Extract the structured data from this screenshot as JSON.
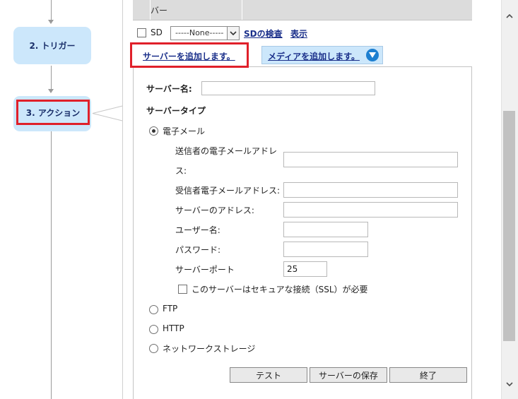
{
  "steps": [
    {
      "label": "2. トリガー"
    },
    {
      "label": "3. アクション"
    }
  ],
  "table_header": {
    "col_fragment": "バー"
  },
  "sd_row": {
    "checkbox_label": "SD",
    "select_value": "-----None-----",
    "link_check": "SDの検査",
    "link_show": "表示"
  },
  "tabs": {
    "add_server": "サーバーを追加します。",
    "add_media": "メディアを追加します。"
  },
  "form": {
    "server_name_label": "サーバー名:",
    "server_name_value": "",
    "server_type_label": "サーバータイプ",
    "radio_email": "電子メール",
    "sender_email_label_line1": "送信者の電子メールアドレ",
    "sender_email_label_line2": "ス:",
    "recipient_email_label": "受信者電子メールアドレス:",
    "server_address_label": "サーバーのアドレス:",
    "username_label": "ユーザー名:",
    "password_label": "パスワード:",
    "server_port_label": "サーバーポート",
    "server_port_value": "25",
    "ssl_label": "このサーバーはセキュアな接続（SSL）が必要",
    "radio_ftp": "FTP",
    "radio_http": "HTTP",
    "radio_storage": "ネットワークストレージ",
    "selected_type": "email"
  },
  "buttons": {
    "test": "テスト",
    "save": "サーバーの保存",
    "close": "終了"
  },
  "colors": {
    "highlight_red": "#e0202a",
    "step_blue": "#cce7fb",
    "link_blue": "#1a2f8a",
    "info_icon_blue": "#1d7fd0"
  }
}
